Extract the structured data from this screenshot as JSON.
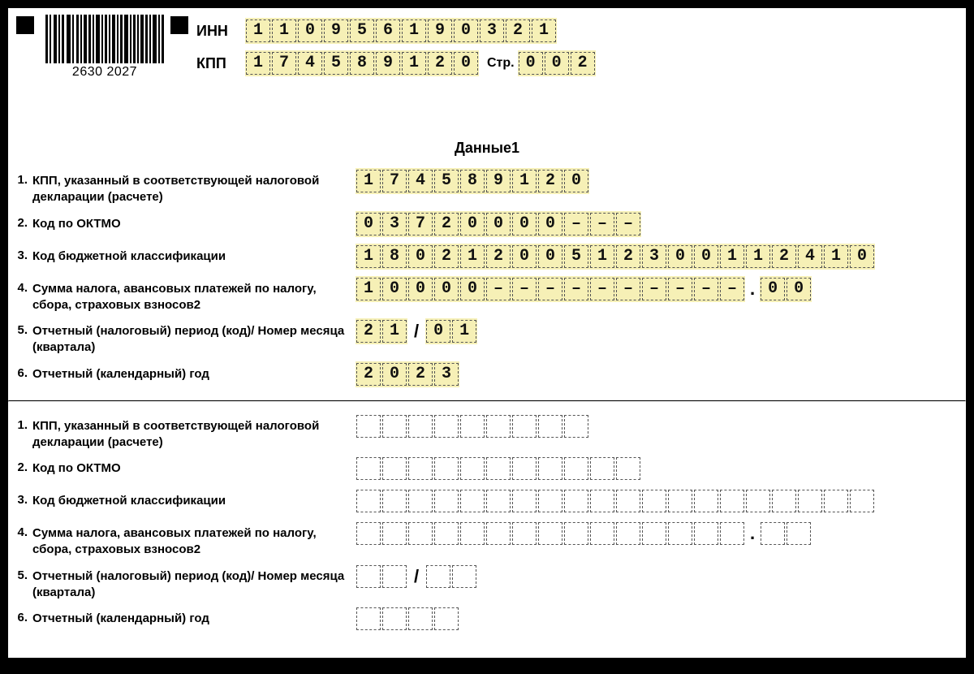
{
  "barcode_text": "2630 2027",
  "header": {
    "inn_label": "ИНН",
    "kpp_label": "КПП",
    "page_label": "Стр.",
    "inn": [
      "1",
      "1",
      "0",
      "9",
      "5",
      "6",
      "1",
      "9",
      "0",
      "3",
      "2",
      "1"
    ],
    "kpp": [
      "1",
      "7",
      "4",
      "5",
      "8",
      "9",
      "1",
      "2",
      "0"
    ],
    "page": [
      "0",
      "0",
      "2"
    ]
  },
  "section_title": "Данные1",
  "labels": {
    "r1_num": "1.",
    "r1": "КПП, указанный в соответствующей налоговой декларации (расчете)",
    "r2_num": "2.",
    "r2": "Код по ОКТМО",
    "r3_num": "3.",
    "r3": "Код бюджетной классификации",
    "r4_num": "4.",
    "r4": "Сумма налога, авансовых платежей по налогу, сбора, страховых взносов2",
    "r5_num": "5.",
    "r5": "Отчетный (налоговый) период (код)/ Номер месяца (квартала)",
    "r6_num": "6.",
    "r6": "Отчетный (календарный) год",
    "slash": "/",
    "dot": "."
  },
  "block1": {
    "kpp": [
      "1",
      "7",
      "4",
      "5",
      "8",
      "9",
      "1",
      "2",
      "0"
    ],
    "oktmo": [
      "0",
      "3",
      "7",
      "2",
      "0",
      "0",
      "0",
      "0",
      "–",
      "–",
      "–"
    ],
    "kbk": [
      "1",
      "8",
      "0",
      "2",
      "1",
      "2",
      "0",
      "0",
      "5",
      "1",
      "2",
      "3",
      "0",
      "0",
      "1",
      "1",
      "2",
      "4",
      "1",
      "0"
    ],
    "sum_int": [
      "1",
      "0",
      "0",
      "0",
      "0",
      "–",
      "–",
      "–",
      "–",
      "–",
      "–",
      "–",
      "–",
      "–",
      "–"
    ],
    "sum_frac": [
      "0",
      "0"
    ],
    "period_a": [
      "2",
      "1"
    ],
    "period_b": [
      "0",
      "1"
    ],
    "year": [
      "2",
      "0",
      "2",
      "3"
    ]
  },
  "block2": {
    "kpp_len": 9,
    "oktmo_len": 11,
    "kbk_len": 20,
    "sum_int_len": 15,
    "sum_frac_len": 2,
    "period_a_len": 2,
    "period_b_len": 2,
    "year_len": 4
  }
}
